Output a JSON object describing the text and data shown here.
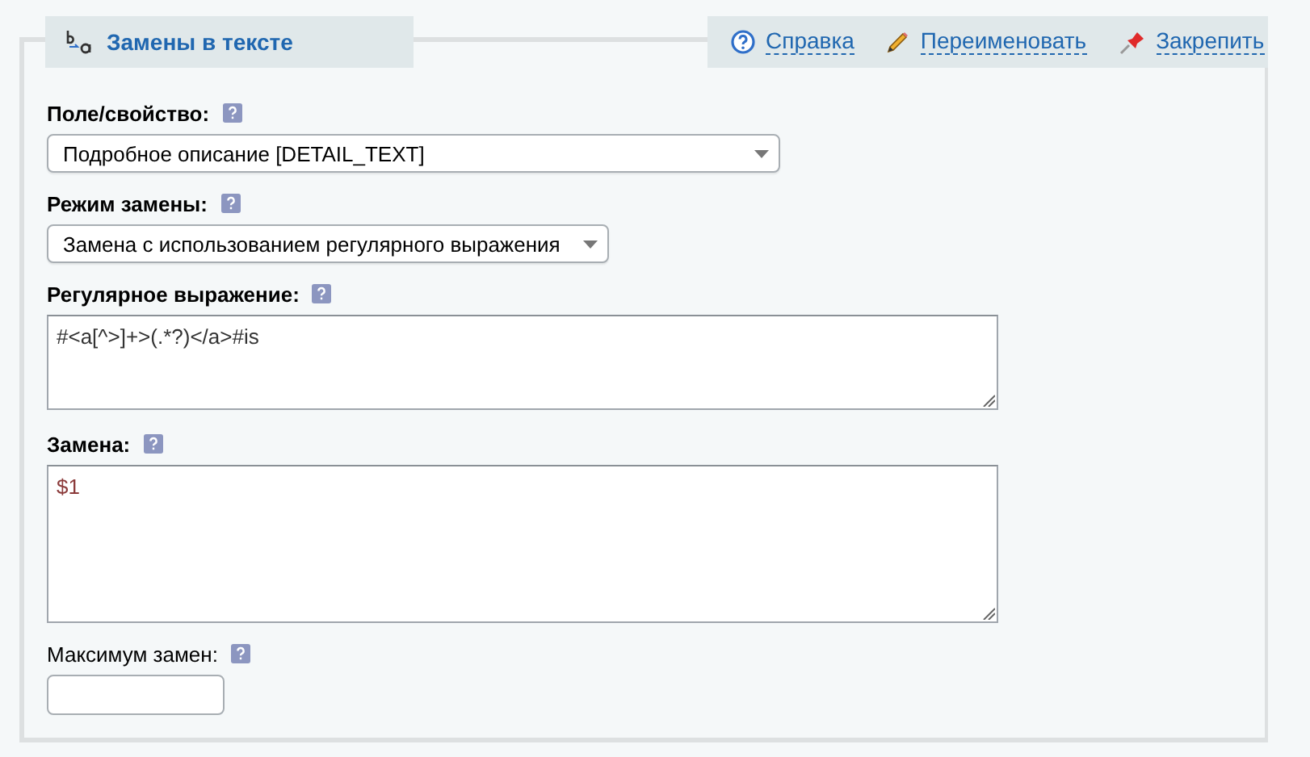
{
  "panel": {
    "title": "Замены в тексте"
  },
  "actions": [
    {
      "kind": "help",
      "label": "Справка"
    },
    {
      "kind": "rename",
      "label": "Переименовать"
    },
    {
      "kind": "pin",
      "label": "Закрепить"
    }
  ],
  "fields": [
    {
      "kind": "select",
      "label": "Поле/свойство:",
      "bold": true,
      "value": "Подробное описание [DETAIL_TEXT]"
    },
    {
      "kind": "select",
      "label": "Режим замены:",
      "bold": true,
      "value": "Замена с использованием регулярного выражения"
    },
    {
      "kind": "textarea",
      "label": "Регулярное выражение:",
      "bold": true,
      "value": "#<a[^>]+>(.*?)</a>#is"
    },
    {
      "kind": "textarea",
      "label": "Замена:",
      "bold": true,
      "value": "$1"
    },
    {
      "kind": "input",
      "label": "Максимум замен:",
      "bold": false
    }
  ]
}
